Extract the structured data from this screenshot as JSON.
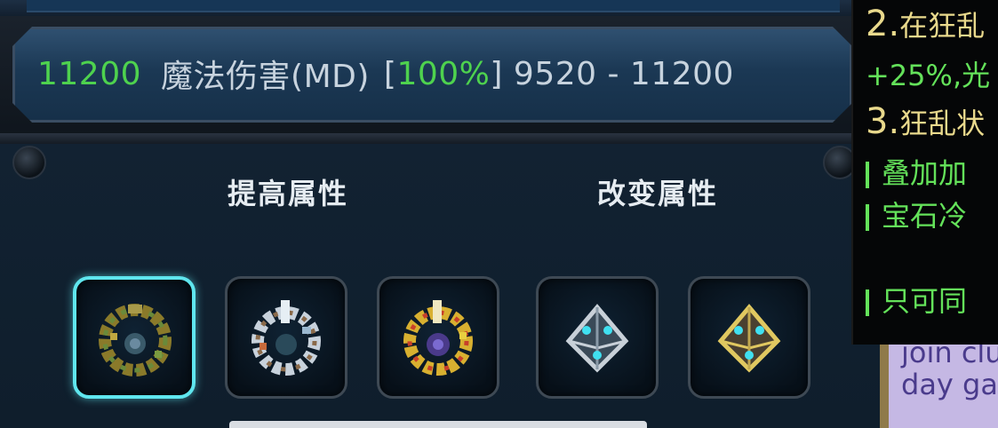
{
  "stat": {
    "value": "11200",
    "name": "魔法伤害(MD)",
    "bracket_open": "[",
    "percent": "100%",
    "bracket_close": "]",
    "range": "9520 - 11200"
  },
  "sections": {
    "improve_title": "提高属性",
    "change_title": "改变属性"
  },
  "slots": [
    {
      "name": "gem-1",
      "selected": true
    },
    {
      "name": "gem-2",
      "selected": false
    },
    {
      "name": "gem-3",
      "selected": false
    },
    {
      "name": "crystal-1",
      "selected": false
    },
    {
      "name": "crystal-2",
      "selected": false
    }
  ],
  "tooltip": {
    "line2_num": "2.",
    "line2_text": "在狂乱",
    "line2b": "+25%,光",
    "line3_num": "3.",
    "line3_text": "狂乱状",
    "bullet1": "叠加加",
    "bullet2": "宝石冷",
    "bullet3": "只可同"
  },
  "chat": {
    "line1": "join clu",
    "line2": "day ga"
  },
  "colors": {
    "green": "#4ed24e",
    "selected_border": "#5fe6ee",
    "tooltip_gold": "#e9d98c"
  }
}
